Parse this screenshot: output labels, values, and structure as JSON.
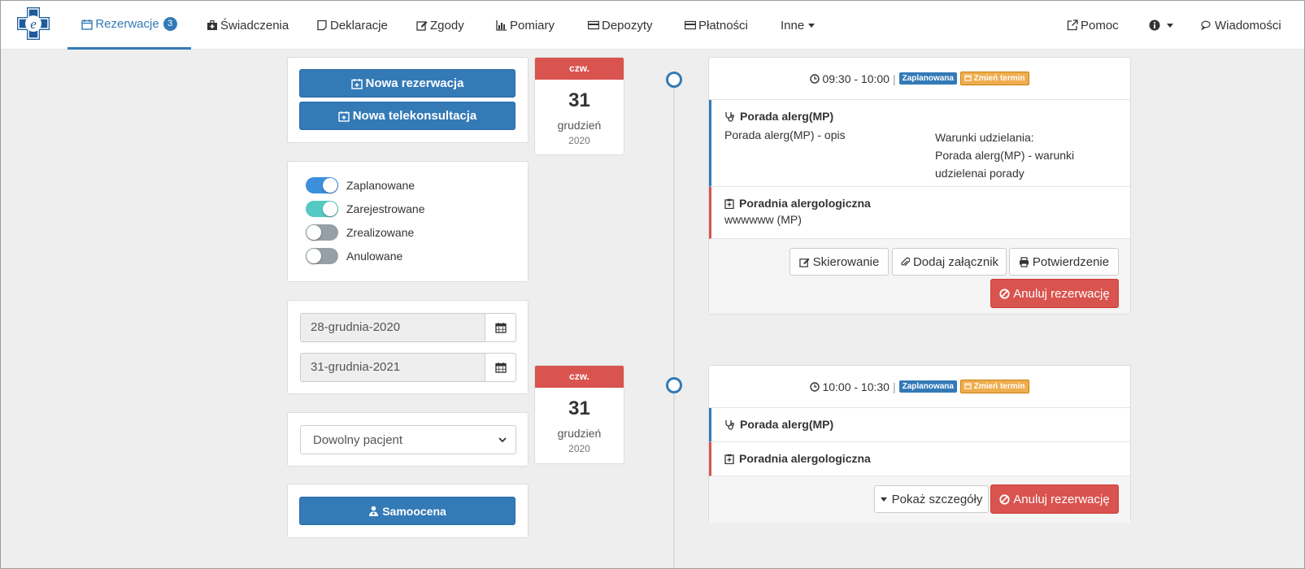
{
  "nav": {
    "items": [
      {
        "label": "Rezerwacje",
        "badge": "3"
      },
      {
        "label": "Świadczenia"
      },
      {
        "label": "Deklaracje"
      },
      {
        "label": "Zgody"
      },
      {
        "label": "Pomiary"
      },
      {
        "label": "Depozyty"
      },
      {
        "label": "Płatności"
      },
      {
        "label": "Inne"
      }
    ],
    "right": {
      "help": "Pomoc",
      "messages": "Wiadomości"
    }
  },
  "sidebar": {
    "new_reservation": "Nowa rezerwacja",
    "new_teleconsult": "Nowa telekonsultacja",
    "filters": [
      {
        "label": "Zaplanowane",
        "on": true,
        "color": "#3b8fdc"
      },
      {
        "label": "Zarejestrowane",
        "on": true,
        "color": "#55c9c3"
      },
      {
        "label": "Zrealizowane",
        "on": false,
        "color": "#95a0a6"
      },
      {
        "label": "Anulowane",
        "on": false,
        "color": "#95a0a6"
      }
    ],
    "date_from": "28-grudnia-2020",
    "date_to": "31-grudnia-2021",
    "patient_select": "Dowolny pacjent",
    "self_assessment": "Samoocena"
  },
  "appointments": [
    {
      "date": {
        "dow": "czw.",
        "day": "31",
        "month": "grudzień",
        "year": "2020"
      },
      "time": "09:30 - 10:00",
      "status": "Zaplanowana",
      "change": "Zmień termin",
      "service": {
        "title": "Porada alerg(MP)",
        "desc": "Porada alerg(MP) - opis",
        "conditions_label": "Warunki udzielania:",
        "conditions": "Porada alerg(MP) - warunki udzielenai porady"
      },
      "clinic": {
        "title": "Poradnia alergologiczna",
        "desc": "wwwwww (MP)"
      },
      "buttons": {
        "referral": "Skierowanie",
        "attach": "Dodaj załącznik",
        "confirm": "Potwierdzenie",
        "cancel": "Anuluj rezerwację"
      }
    },
    {
      "date": {
        "dow": "czw.",
        "day": "31",
        "month": "grudzień",
        "year": "2020"
      },
      "time": "10:00 - 10:30",
      "status": "Zaplanowana",
      "change": "Zmień termin",
      "service": {
        "title": "Porada alerg(MP)"
      },
      "clinic": {
        "title": "Poradnia alergologiczna"
      },
      "buttons": {
        "details": "Pokaż szczegóły",
        "cancel": "Anuluj rezerwację"
      }
    }
  ],
  "colors": {
    "primary": "#337ab7",
    "danger": "#d9534f",
    "warning": "#f0ad4e"
  }
}
